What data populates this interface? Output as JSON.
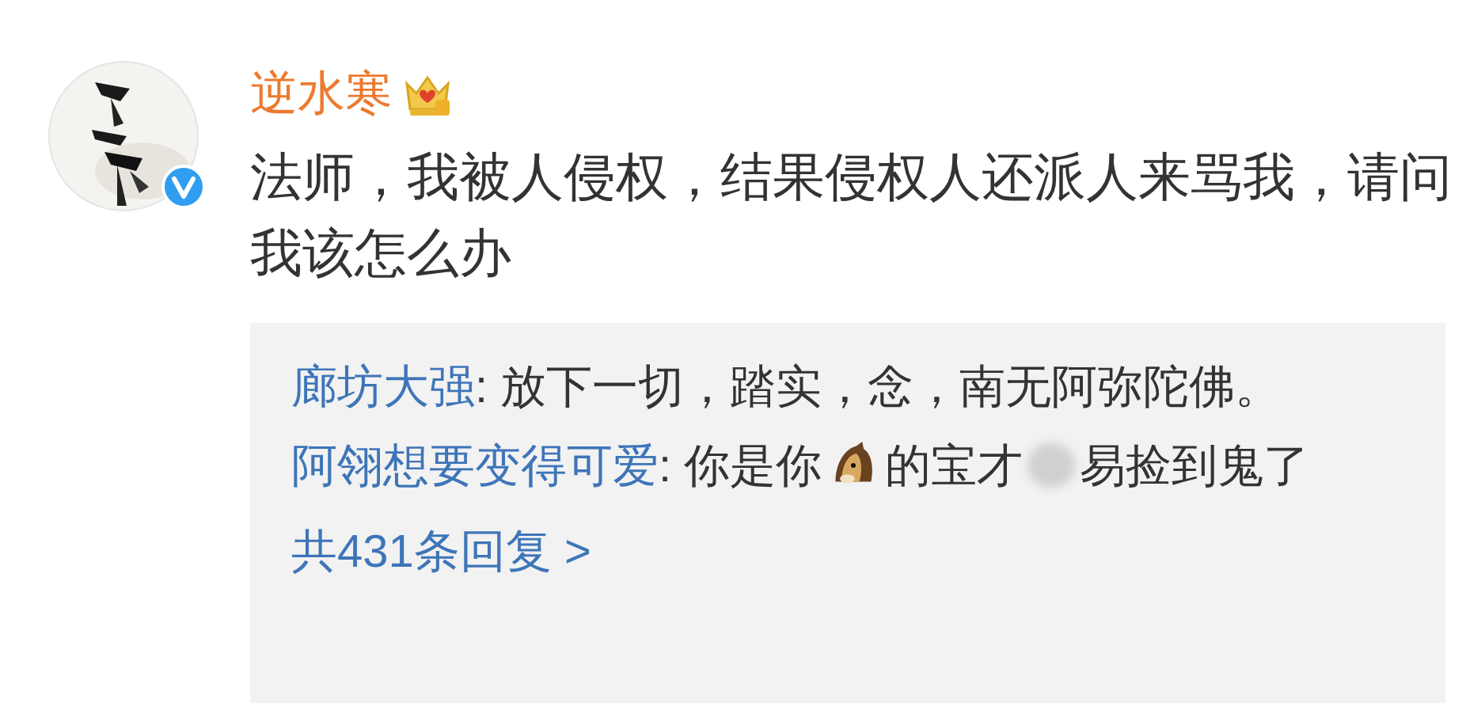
{
  "post": {
    "username": "逆水寒",
    "verified": true,
    "crown_badge": true,
    "text": "法师，我被人侵权，结果侵权人还派人来骂我，请问我该怎么办"
  },
  "replies": [
    {
      "user": "廊坊大强",
      "segments": [
        {
          "kind": "text",
          "text": ": 放下一切，踏实，念，南无阿弥陀佛。"
        }
      ]
    },
    {
      "user": "阿翎想要变得可爱",
      "segments": [
        {
          "kind": "text",
          "text": ": 你是你"
        },
        {
          "kind": "emoji"
        },
        {
          "kind": "text",
          "text": "的宝才"
        },
        {
          "kind": "blur"
        },
        {
          "kind": "text",
          "text": "易捡到鬼了"
        }
      ]
    }
  ],
  "more_replies": "共431条回复 >"
}
